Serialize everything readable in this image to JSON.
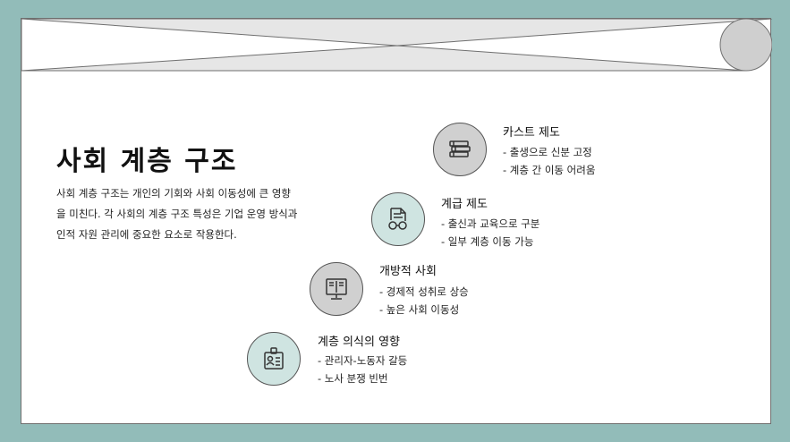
{
  "slide": {
    "title": "사회 계층 구조",
    "description": "사회 계층 구조는 개인의 기회와 사회 이동성에 큰 영향을 미친다. 각 사회의 계층 구조 특성은 기업 운영 방식과 인적 자원 관리에 중요한 요소로 작용한다."
  },
  "items": [
    {
      "title": "카스트 제도",
      "lines": [
        "- 출생으로 신분 고정",
        "- 계층 간 이동 어려움"
      ],
      "icon": "books-icon",
      "style": "gray"
    },
    {
      "title": "계급 제도",
      "lines": [
        "- 출신과 교육으로 구분",
        "- 일부 계층 이동 가능"
      ],
      "icon": "document-glasses-icon",
      "style": "teal"
    },
    {
      "title": "개방적 사회",
      "lines": [
        "- 경제적 성취로 상승",
        "- 높은 사회 이동성"
      ],
      "icon": "book-monitor-icon",
      "style": "gray"
    },
    {
      "title": "계층 의식의 영향",
      "lines": [
        "- 관리자-노동자 갈등",
        "- 노사 분쟁 빈번"
      ],
      "icon": "id-badge-icon",
      "style": "teal"
    }
  ],
  "colors": {
    "background": "#92bcb9",
    "slide": "#ffffff",
    "banner": "#e6e6e6",
    "circle_gray": "#d0d0d0",
    "circle_teal": "#cfe4e1"
  }
}
